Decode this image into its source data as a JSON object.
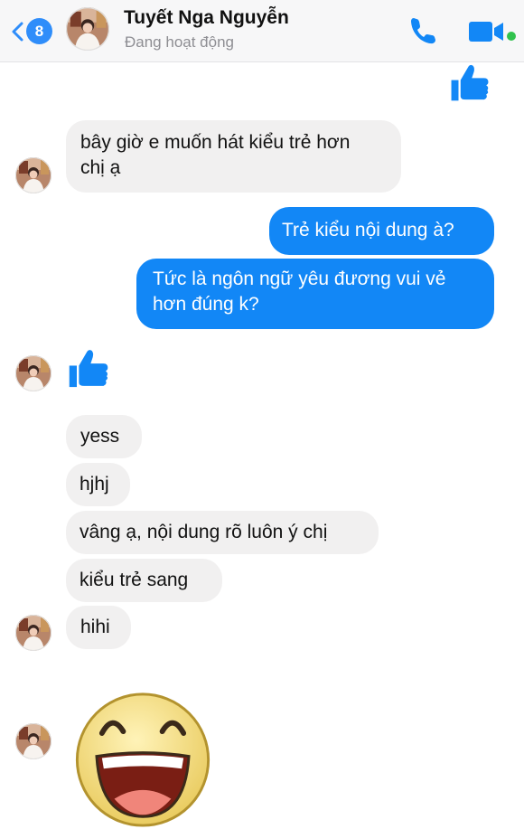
{
  "header": {
    "back_count": "8",
    "name": "Tuyết Nga Nguyễn",
    "status": "Đang hoạt động"
  },
  "icons": {
    "back": "chevron-left-icon",
    "call": "phone-icon",
    "video": "video-camera-icon",
    "like": "thumbs-up-icon",
    "emoji": "laughing-face-icon"
  },
  "colors": {
    "accent": "#1287f6",
    "incoming_bubble": "#f1f0f0",
    "online_dot": "#31c24d"
  },
  "messages": [
    {
      "sender": "me",
      "kind": "like"
    },
    {
      "sender": "them",
      "kind": "text",
      "text": "bây giờ e muốn hát kiểu trẻ hơn\nchị ạ"
    },
    {
      "sender": "me",
      "kind": "text",
      "text": "Trẻ kiểu nội dung à?"
    },
    {
      "sender": "me",
      "kind": "text",
      "text": "Tức là ngôn ngữ yêu đương vui vẻ\nhơn đúng k?"
    },
    {
      "sender": "them",
      "kind": "like"
    },
    {
      "sender": "them",
      "kind": "text",
      "text": "yess"
    },
    {
      "sender": "them",
      "kind": "text",
      "text": "hjhj"
    },
    {
      "sender": "them",
      "kind": "text",
      "text": "vâng ạ, nội dung rõ luôn ý chị"
    },
    {
      "sender": "them",
      "kind": "text",
      "text": "kiểu trẻ sang"
    },
    {
      "sender": "them",
      "kind": "text",
      "text": "hihi"
    },
    {
      "sender": "them",
      "kind": "sticker"
    }
  ]
}
